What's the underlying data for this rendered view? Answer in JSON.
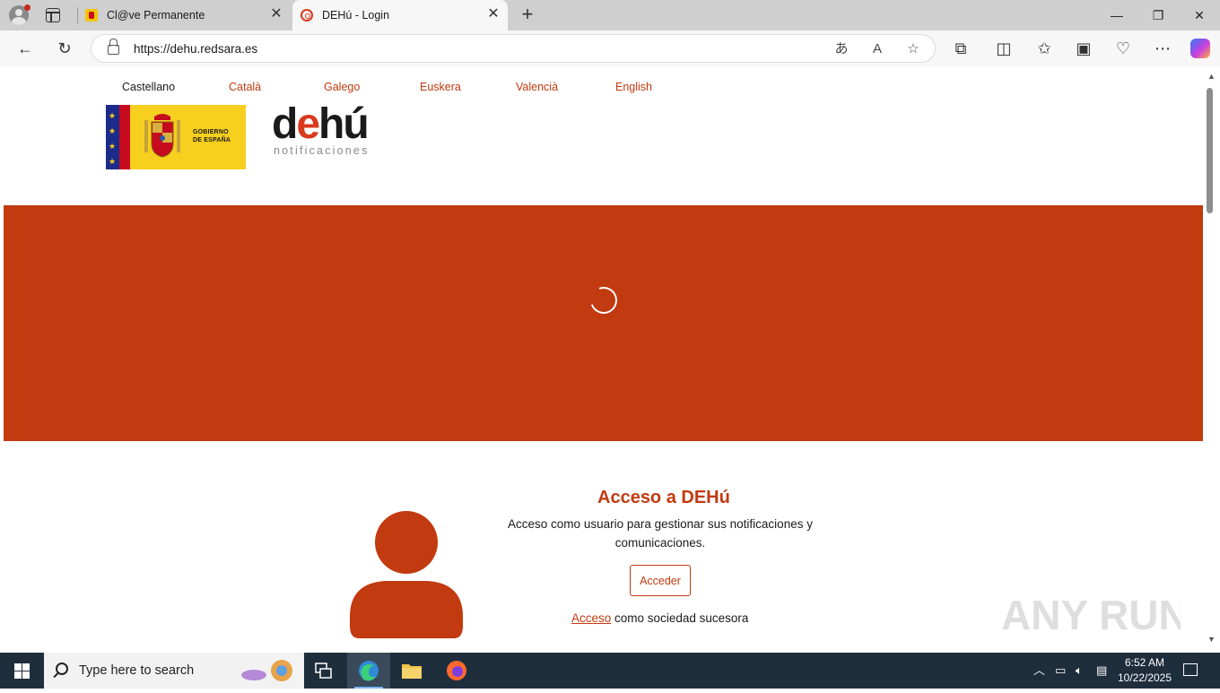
{
  "browser": {
    "tabs": [
      {
        "title": "Cl@ve Permanente",
        "active": false
      },
      {
        "title": "DEHú - Login",
        "active": true
      }
    ],
    "url": "https://dehu.redsara.es",
    "colors": {
      "chrome": "#cfcfcf",
      "toolbar": "#f7f7f7"
    }
  },
  "page": {
    "languages": [
      "Castellano",
      "Català",
      "Galego",
      "Euskera",
      "Valencià",
      "English"
    ],
    "current_language": "Castellano",
    "gov_logo_text": [
      "GOBIERNO",
      "DE ESPAÑA"
    ],
    "dehu_logo": {
      "word": "dehú",
      "sub": "notificaciones"
    },
    "access": {
      "title": "Acceso a DEHú",
      "description": "Acceso como usuario para gestionar sus notificaciones y comunicaciones.",
      "button": "Acceder",
      "successor_link": "Acceso",
      "successor_text": "como sociedad sucesora"
    },
    "colors": {
      "brand": "#c23a0f",
      "banner": "#c23a0f"
    }
  },
  "watermark": "ANY RUN",
  "taskbar": {
    "search_placeholder": "Type here to search",
    "time": "6:52 AM",
    "date": "10/22/2025"
  }
}
